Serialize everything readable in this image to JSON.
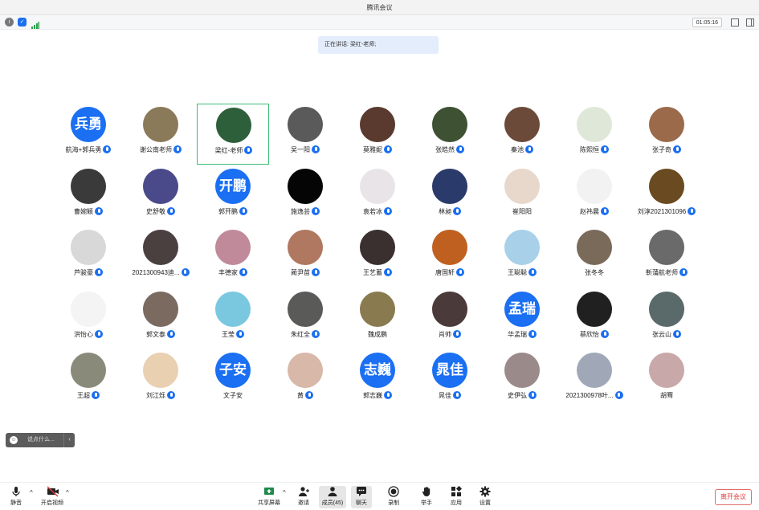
{
  "window": {
    "title": "腾讯会议"
  },
  "status": {
    "timer": "01:05:16",
    "icons": [
      "info-icon",
      "shield-icon",
      "signal-icon",
      "fullscreen-icon",
      "sidebar-icon"
    ]
  },
  "speaking": {
    "label": "正在讲话: 梁红-老师;"
  },
  "participants": [
    {
      "name": "航海+郭兵勇",
      "avatar_text": "兵勇",
      "avatar_color": "#1a6ff2",
      "mic": true
    },
    {
      "name": "谢公南老师",
      "avatar_color": "#8a7a5a",
      "mic": true
    },
    {
      "name": "梁红-老师",
      "avatar_color": "#2d5f3a",
      "mic": true,
      "active": true
    },
    {
      "name": "吴一阳",
      "avatar_color": "#5a5a5a",
      "mic": true
    },
    {
      "name": "莫雅妮",
      "avatar_color": "#5a3a2f",
      "mic": true
    },
    {
      "name": "张皓然",
      "avatar_color": "#3e5233",
      "mic": true
    },
    {
      "name": "秦池",
      "avatar_color": "#6b4a3a",
      "mic": true
    },
    {
      "name": "陈熙恒",
      "avatar_color": "#dfe8d8",
      "mic": true
    },
    {
      "name": "张子奇",
      "avatar_color": "#9a6a4a",
      "mic": true
    },
    {
      "name": "曹婉颖",
      "avatar_color": "#3a3a3a",
      "mic": true
    },
    {
      "name": "史舒敬",
      "avatar_color": "#4a4a8a",
      "mic": true
    },
    {
      "name": "郭开鹏",
      "avatar_text": "开鹏",
      "avatar_color": "#1a6ff2",
      "mic": true
    },
    {
      "name": "施逸芸",
      "avatar_color": "#050505",
      "mic": true
    },
    {
      "name": "袁若冰",
      "avatar_color": "#e9e4e8",
      "mic": true
    },
    {
      "name": "林昶",
      "avatar_color": "#2a3a6a",
      "mic": true
    },
    {
      "name": "崔阳阳",
      "avatar_color": "#e8d8cc",
      "mic": false
    },
    {
      "name": "赵祎晨",
      "avatar_color": "#f2f2f2",
      "mic": true
    },
    {
      "name": "刘淳2021301096",
      "avatar_color": "#6a4a20",
      "mic": true
    },
    {
      "name": "芦骏豪",
      "avatar_color": "#d8d8d8",
      "mic": true
    },
    {
      "name": "2021300943迪...",
      "avatar_color": "#4a4040",
      "mic": true
    },
    {
      "name": "丰德家",
      "avatar_color": "#c08a9a",
      "mic": true
    },
    {
      "name": "蔺尹苗",
      "avatar_color": "#b07860",
      "mic": true
    },
    {
      "name": "王艺蓄",
      "avatar_color": "#3a3030",
      "mic": true
    },
    {
      "name": "唐国轩",
      "avatar_color": "#c06020",
      "mic": true
    },
    {
      "name": "王聪聪",
      "avatar_color": "#a8d0e8",
      "mic": true
    },
    {
      "name": "张冬冬",
      "avatar_color": "#7a6a5a",
      "mic": false
    },
    {
      "name": "靳蒲航老师",
      "avatar_color": "#6a6a6a",
      "mic": true
    },
    {
      "name": "洪怡心",
      "avatar_color": "#f4f4f4",
      "mic": true
    },
    {
      "name": "郭文泰",
      "avatar_color": "#7a6a60",
      "mic": true
    },
    {
      "name": "王莹",
      "avatar_color": "#7ac8e0",
      "mic": true
    },
    {
      "name": "朱红全",
      "avatar_color": "#5a5a58",
      "mic": true
    },
    {
      "name": "魏成鹏",
      "avatar_color": "#8a7a50",
      "mic": false
    },
    {
      "name": "肖帅",
      "avatar_color": "#4a3a3a",
      "mic": true
    },
    {
      "name": "华孟瑞",
      "avatar_text": "孟瑞",
      "avatar_color": "#1a6ff2",
      "mic": true
    },
    {
      "name": "蔡欣怡",
      "avatar_color": "#202020",
      "mic": true
    },
    {
      "name": "张云山",
      "avatar_color": "#5a6a6a",
      "mic": true
    },
    {
      "name": "王超",
      "avatar_color": "#8a8a7a",
      "mic": true
    },
    {
      "name": "刘江烁",
      "avatar_color": "#e8d0b0",
      "mic": true
    },
    {
      "name": "文子安",
      "avatar_text": "子安",
      "avatar_color": "#1a6ff2",
      "mic": false
    },
    {
      "name": "黄",
      "avatar_color": "#d8b8a8",
      "mic": true
    },
    {
      "name": "郭志巍",
      "avatar_text": "志巍",
      "avatar_color": "#1a6ff2",
      "mic": true
    },
    {
      "name": "晁佳",
      "avatar_text": "晁佳",
      "avatar_color": "#1a6ff2",
      "mic": true
    },
    {
      "name": "史伊弘",
      "avatar_color": "#9a8a8a",
      "mic": true
    },
    {
      "name": "2021300978叶...",
      "avatar_color": "#a0a8b8",
      "mic": true
    },
    {
      "name": "胡骞",
      "avatar_color": "#c8a8a8",
      "mic": false
    }
  ],
  "chat": {
    "placeholder": "说点什么...",
    "collapse": "‹"
  },
  "toolbar": {
    "mute": "静音",
    "video": "开启视频",
    "share": "共享屏幕",
    "invite": "邀请",
    "members": "成员(45)",
    "chat": "聊天",
    "record": "录制",
    "raise_hand": "举手",
    "apps": "应用",
    "settings": "设置",
    "leave": "离开会议"
  }
}
